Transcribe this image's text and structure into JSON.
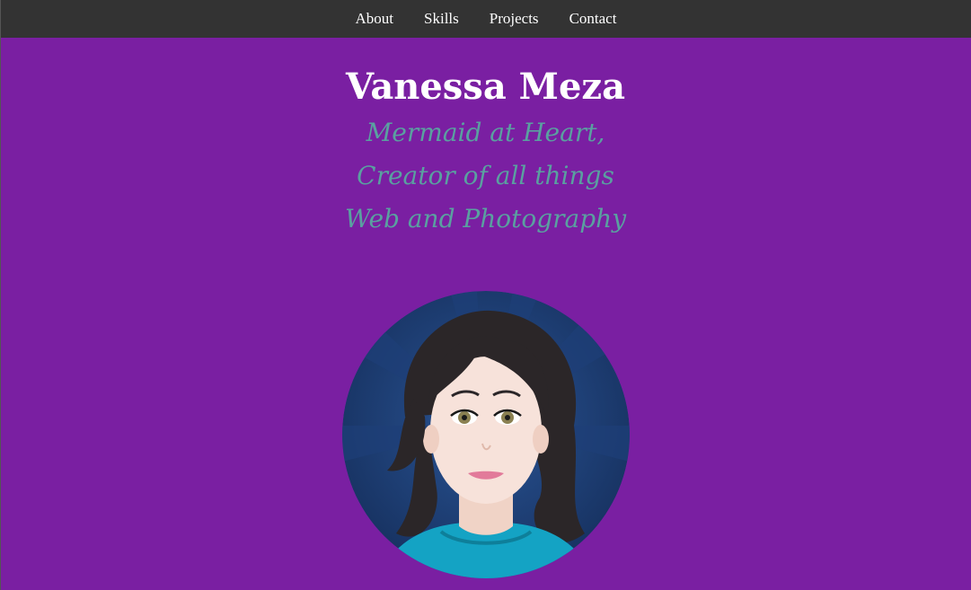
{
  "nav": {
    "items": [
      {
        "label": "About"
      },
      {
        "label": "Skills"
      },
      {
        "label": "Projects"
      },
      {
        "label": "Contact"
      }
    ]
  },
  "hero": {
    "name": "Vanessa Meza",
    "tagline": [
      "Mermaid at Heart,",
      "Creator of all things",
      "Web and Photography"
    ]
  },
  "colors": {
    "background": "#7a1fa2",
    "nav_bg": "#333333",
    "tagline": "#5aa0a0"
  },
  "avatar": {
    "icon": "woman-portrait-avatar-icon"
  }
}
